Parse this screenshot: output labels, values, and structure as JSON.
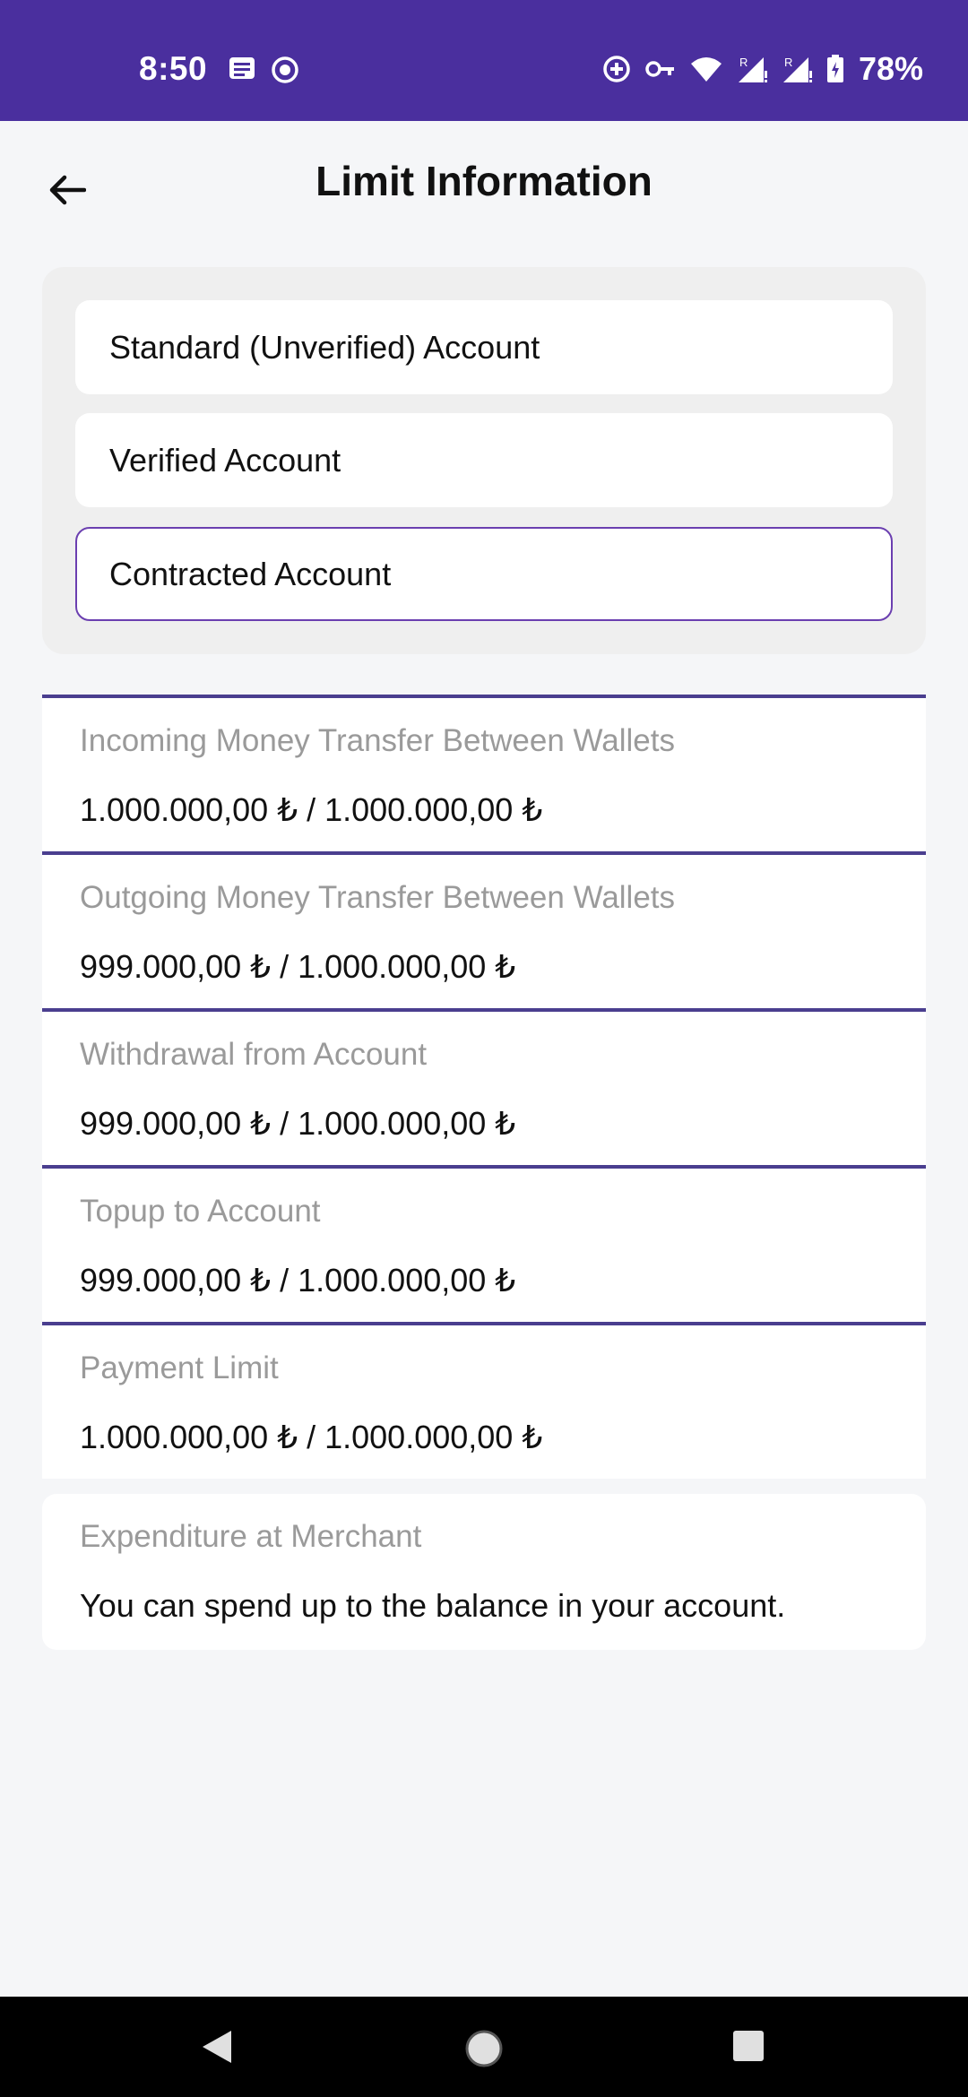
{
  "status_bar": {
    "time": "8:50",
    "battery": "78%",
    "icons": [
      "message-icon",
      "record-icon",
      "data-saver-icon",
      "vpn-key-icon",
      "wifi-icon",
      "signal-r-icon",
      "signal-r-icon",
      "battery-icon"
    ]
  },
  "header": {
    "title": "Limit Information",
    "back_icon": "arrow-left-icon"
  },
  "account_types": {
    "options": [
      "Standard (Unverified) Account",
      "Verified Account",
      "Contracted Account"
    ],
    "selected": "Contracted Account"
  },
  "limits": [
    {
      "label": "Incoming Money Transfer Between Wallets",
      "value": "1.000.000,00 ₺ / 1.000.000,00 ₺"
    },
    {
      "label": "Outgoing Money Transfer Between Wallets",
      "value": "999.000,00 ₺ / 1.000.000,00 ₺"
    },
    {
      "label": "Withdrawal from Account",
      "value": "999.000,00 ₺ / 1.000.000,00 ₺"
    },
    {
      "label": "Topup to Account",
      "value": "999.000,00 ₺ / 1.000.000,00 ₺"
    },
    {
      "label": "Payment Limit",
      "value": "1.000.000,00 ₺ / 1.000.000,00 ₺"
    }
  ],
  "expenditure": {
    "label": "Expenditure at Merchant",
    "value": "You can spend up to the balance in your account."
  },
  "colors": {
    "status_bar": "#4a2f9e",
    "accent": "#6b3fb0",
    "divider": "#4a3e8f",
    "label_gray": "#9a9a9a"
  }
}
